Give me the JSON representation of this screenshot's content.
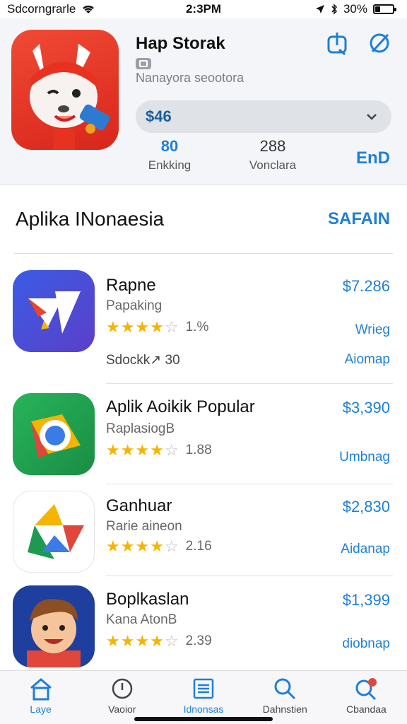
{
  "status_bar": {
    "carrier": "Sdcorngrarle",
    "time": "2:3PM",
    "battery": "30%",
    "battery_level": 0.3
  },
  "header": {
    "app_title": "Hap Storak",
    "developer": "Nanayora seootora",
    "price": "$46",
    "stats": [
      {
        "value": "80",
        "label": "Enkking"
      },
      {
        "value": "288",
        "label": "Vonclara"
      }
    ],
    "get_label": "EnD"
  },
  "section": {
    "title": "Aplika INonaesia",
    "link": "SAFAIN"
  },
  "apps": [
    {
      "name": "Rapne",
      "subtitle": "Papaking",
      "rating": 4,
      "rating_text": "1.%",
      "price": "$7.286",
      "action": "Wrieg",
      "extra": "Sdockk↗ 30",
      "action2": "Aiomap"
    },
    {
      "name": "Aplik Aoikik Popular",
      "subtitle": "RaplasiogB",
      "rating": 4,
      "rating_text": "1.88",
      "price": "$3,390",
      "action": "Umbnag"
    },
    {
      "name": "Ganhuar",
      "subtitle": "Rarie aineon",
      "rating": 4,
      "rating_text": "2.16",
      "price": "$2,830",
      "action": "Aidanap"
    },
    {
      "name": "Boplkaslan",
      "subtitle": "Kana AtonB",
      "rating": 4,
      "rating_text": "2.39",
      "price": "$1,399",
      "action": "diobnap"
    }
  ],
  "tabs": [
    {
      "label": "Laye",
      "icon": "home-icon"
    },
    {
      "label": "Vaoior",
      "icon": "clock-icon"
    },
    {
      "label": "Idnonsas",
      "icon": "list-icon"
    },
    {
      "label": "Dahnstien",
      "icon": "search-icon"
    },
    {
      "label": "Cbandaa",
      "icon": "search-badge-icon"
    }
  ],
  "colors": {
    "accent": "#1e7fd8",
    "star": "#f4b400"
  }
}
